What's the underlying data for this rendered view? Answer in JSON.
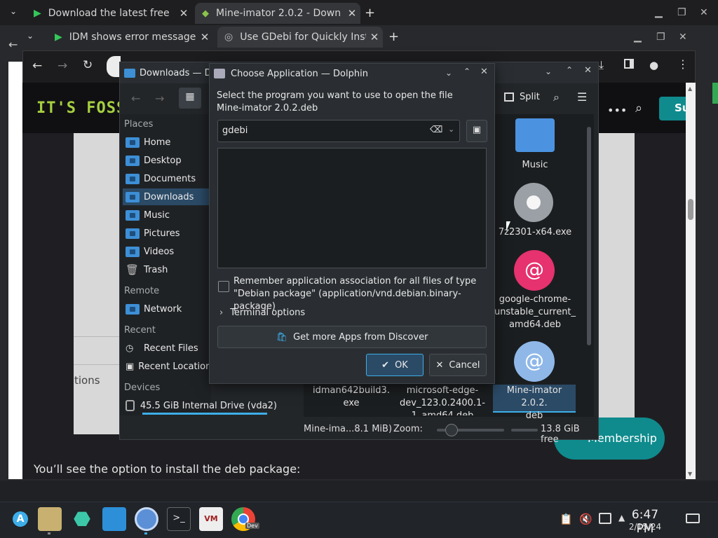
{
  "browser": {
    "tabs_row1": [
      {
        "label": "Download the latest free",
        "active": false
      },
      {
        "label": "Mine-imator 2.0.2 - Down",
        "active": true
      }
    ],
    "tabs_row2": [
      {
        "label": "IDM shows error message v",
        "active": false
      },
      {
        "label": "Use GDebi for Quickly Inst",
        "active": true
      }
    ]
  },
  "site": {
    "logo": "IT'S FOSS",
    "subscribe": "Su",
    "side_text": "tions",
    "body_text": "You’ll see the option to install the deb package:",
    "membership": "Membership"
  },
  "dolphin": {
    "title": "Downloads — Do",
    "split_label": "Split",
    "places_header": "Places",
    "places": [
      "Home",
      "Desktop",
      "Documents",
      "Downloads",
      "Music",
      "Pictures",
      "Videos",
      "Trash"
    ],
    "remote_header": "Remote",
    "remote": [
      "Network"
    ],
    "recent_header": "Recent",
    "recent": [
      "Recent Files",
      "Recent Locations"
    ],
    "devices_header": "Devices",
    "devices": [
      "45.5 GiB Internal Drive (vda2)"
    ],
    "files": {
      "music": "Music",
      "exe": "7z2301-x64.exe",
      "chrome_l1": "google-chrome-",
      "chrome_l2": "unstable_current_",
      "chrome_l3": "amd64.deb",
      "mine_l1": "Mine-imator 2.0.2.",
      "mine_l2": "deb",
      "idm_l1": "idman642build3.",
      "idm_l2": "exe",
      "edge_l1": "microsoft-edge-",
      "edge_l2": "dev_123.0.2400.1-",
      "edge_l3": "1_amd64.deb"
    },
    "status_file": "Mine-ima...8.1 MiB)",
    "zoom_label": "Zoom:",
    "zoom_level": 0.15,
    "free_space": "13.8 GiB free"
  },
  "dialog": {
    "title": "Choose Application — Dolphin",
    "prompt_l1": "Select the program you want to use to open the file",
    "prompt_l2": "Mine-imator 2.0.2.deb",
    "search_value": "gdebi",
    "remember_l1": "Remember application association for all files of type",
    "remember_l2": "\"Debian package\" (application/vnd.debian.binary-package)",
    "terminal_options": "Terminal options",
    "discover_button": "Get more Apps from Discover",
    "ok": "OK",
    "cancel": "Cancel"
  },
  "taskbar": {
    "time": "6:47 PM",
    "date": "2/15/24",
    "dev_badge": "Dev"
  },
  "colors": {
    "accent": "#3daee9",
    "selection": "#2b4a66",
    "logo_green": "#a6d040",
    "teal": "#0f8b8d"
  }
}
